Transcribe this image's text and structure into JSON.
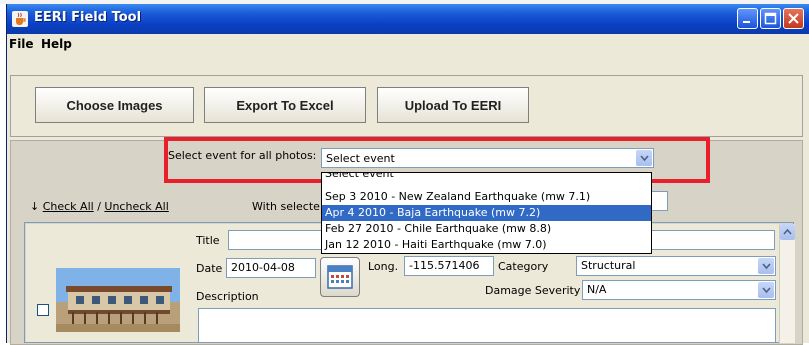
{
  "window": {
    "title": "EERI Field Tool"
  },
  "menu": {
    "file": "File",
    "help": "Help"
  },
  "toolbar": {
    "choose_images": "Choose Images",
    "export_excel": "Export To Excel",
    "upload_eeri": "Upload To EERI"
  },
  "event": {
    "label": "Select event for all photos:",
    "selected": "Select event",
    "options": [
      "Select event",
      "Sep 3 2010 - New Zealand Earthquake (mw 7.1)",
      "Apr 4 2010 - Baja Earthquake (mw 7.2)",
      "Feb 27 2010 - Chile Earthquake (mw 8.8)",
      "Jan 12 2010 - Haiti Earthquake (mw 7.0)"
    ],
    "highlighted_index": 2
  },
  "selection": {
    "arrow": "↓",
    "check_all": "Check All",
    "separator": " / ",
    "uncheck_all": "Uncheck All",
    "with_selected": "With selected:"
  },
  "entry": {
    "title_label": "Title",
    "title_value": "",
    "date_label": "Date",
    "date_value": "2010-04-08",
    "long_label": "Long.",
    "long_value": "-115.571406",
    "category_label": "Category",
    "category_value": "Structural",
    "description_label": "Description",
    "damage_label": "Damage Severity",
    "damage_value": "N/A"
  },
  "colors": {
    "titlebar": "#0a3fc4",
    "highlight_box": "#e8202c",
    "selected_item": "#316ac5"
  }
}
